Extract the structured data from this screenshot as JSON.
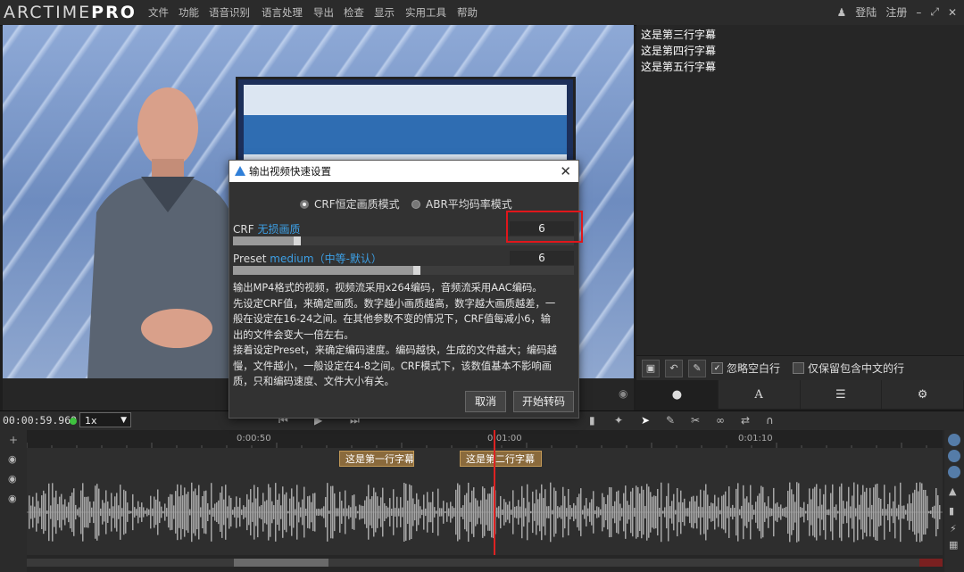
{
  "app": {
    "logo_main": "ARCTIME",
    "logo_pro": "PRO"
  },
  "menu": [
    "文件",
    "功能",
    "语音识别",
    "语言处理",
    "导出",
    "检查",
    "显示",
    "实用工具",
    "帮助"
  ],
  "auth": {
    "login": "登陆",
    "register": "注册"
  },
  "subtitles_panel": {
    "lines": [
      "这是第三行字幕",
      "这是第四行字幕",
      "这是第五行字幕"
    ],
    "ignore_blank_label": "忽略空白行",
    "ignore_blank_checked": true,
    "chinese_only_label": "仅保留包含中文的行",
    "chinese_only_checked": false
  },
  "playback": {
    "timecode": "00:00:59.969",
    "speed": "1x"
  },
  "timeline": {
    "ticks": [
      "0:00:50",
      "0:01:00",
      "0:01:10"
    ],
    "subtitle_blocks": [
      "这是第一行字幕",
      "这是第二行字幕"
    ]
  },
  "dialog": {
    "title": "输出视频快速设置",
    "mode_crf": "CRF恒定画质模式",
    "mode_abr": "ABR平均码率模式",
    "selected_mode": "crf",
    "crf_label": "CRF",
    "crf_quality": "无损画质",
    "crf_value": "6",
    "crf_slider_level": 0.2,
    "preset_label": "Preset",
    "preset_value_text": "medium（中等-默认）",
    "preset_value": "6",
    "preset_slider_level": 0.55,
    "description": [
      "输出MP4格式的视频，视频流采用x264编码，音频流采用AAC编码。",
      "先设定CRF值，来确定画质。数字越小画质越高，数字越大画质越差，一",
      "般在设定在16-24之间。在其他参数不变的情况下，CRF值每减小6，输",
      "出的文件会变大一倍左右。",
      "接着设定Preset，来确定编码速度。编码越快，生成的文件越大；编码越",
      "慢，文件越小，一般设定在4-8之间。CRF模式下，该数值基本不影响画",
      "质，只和编码速度、文件大小有关。"
    ],
    "cancel_button": "取消",
    "start_button": "开始转码"
  },
  "colors": {
    "accent_blue": "#3da0e6",
    "highlight_red": "#e0161b",
    "playhead": "#dd2222",
    "status_green": "#3fc23f"
  }
}
